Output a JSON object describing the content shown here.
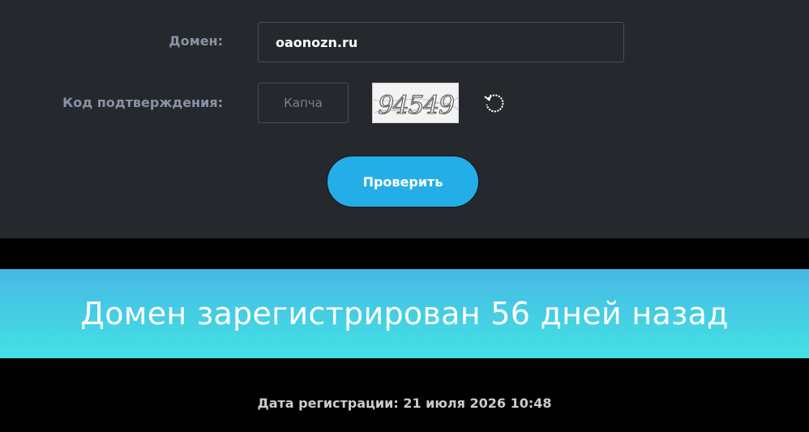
{
  "form": {
    "domain_label": "Домен:",
    "domain_value": "oaonozn.ru",
    "code_label": "Код подтверждения:",
    "captcha_placeholder": "Капча",
    "captcha_image_text": "94549",
    "check_button_label": "Проверить"
  },
  "result": {
    "banner_text": "Домен зарегистрирован 56 дней назад",
    "registration_date": "Дата регистрации: 21 июля 2026 10:48"
  },
  "icons": {
    "refresh": "refresh-icon"
  },
  "colors": {
    "panel_bg": "#25282d",
    "button_bg": "#24aee7",
    "banner_top": "#46b8e4",
    "banner_bottom": "#44e2e4",
    "label": "#8a93a3"
  }
}
